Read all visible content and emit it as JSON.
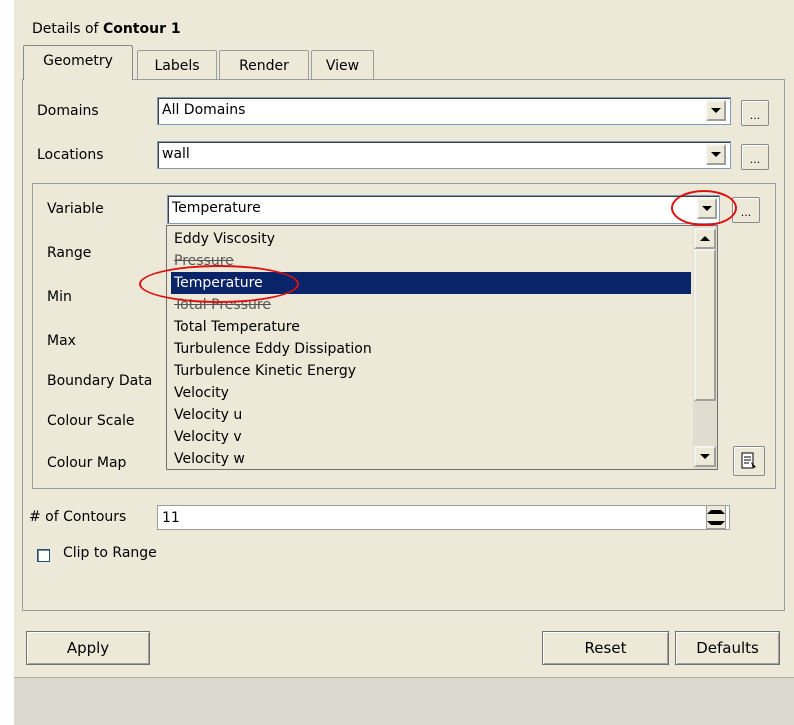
{
  "panel": {
    "title_prefix": "Details of ",
    "title_object": "Contour 1"
  },
  "tabs": [
    {
      "label": "Geometry",
      "active": true
    },
    {
      "label": "Labels"
    },
    {
      "label": "Render"
    },
    {
      "label": "View"
    }
  ],
  "domains": {
    "label": "Domains",
    "value": "All Domains",
    "more_label": "..."
  },
  "locations": {
    "label": "Locations",
    "value": "wall",
    "more_label": "..."
  },
  "variable": {
    "label": "Variable",
    "value": "Temperature",
    "more_label": "...",
    "options": [
      "Eddy Viscosity",
      "Pressure",
      "Temperature",
      "Total Pressure",
      "Total Temperature",
      "Turbulence Eddy Dissipation",
      "Turbulence Kinetic Energy",
      "Velocity",
      "Velocity u",
      "Velocity v",
      "Velocity w"
    ],
    "selected_option": "Temperature"
  },
  "range": {
    "label": "Range"
  },
  "min": {
    "label": "Min"
  },
  "max": {
    "label": "Max"
  },
  "boundary_data": {
    "label": "Boundary Data"
  },
  "colour_scale": {
    "label": "Colour Scale"
  },
  "colour_map": {
    "label": "Colour Map"
  },
  "contours": {
    "label": "# of Contours",
    "value": "11"
  },
  "clip_to_range": {
    "label": "Clip to Range",
    "checked": false
  },
  "buttons": {
    "apply": "Apply",
    "reset": "Reset",
    "defaults": "Defaults"
  },
  "colors": {
    "selection": "#0a246a",
    "annotation": "#e01010",
    "background": "#ece9d8"
  }
}
